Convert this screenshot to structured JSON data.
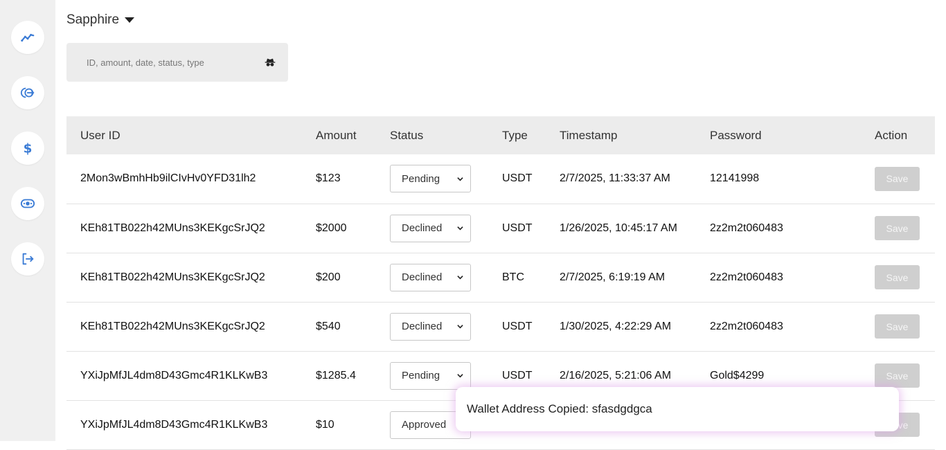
{
  "sidebar": {
    "items": [
      {
        "icon": "chart-line-icon",
        "label": "Analytics"
      },
      {
        "icon": "transfer-icon",
        "label": "Transfers"
      },
      {
        "icon": "dollar-icon",
        "label": "Transactions"
      },
      {
        "icon": "money-icon",
        "label": "Payments"
      },
      {
        "icon": "logout-icon",
        "label": "Logout"
      }
    ],
    "accent_color": "#3a7bd5"
  },
  "site": {
    "selected": "Sapphire"
  },
  "search": {
    "placeholder": "ID, amount, date, status, type"
  },
  "table": {
    "headers": [
      "User ID",
      "Amount",
      "Status",
      "Type",
      "Timestamp",
      "Password",
      "Action"
    ],
    "rows": [
      {
        "user_id": "2Mon3wBmhHb9ilCIvHv0YFD31lh2",
        "amount": "$123",
        "status": "Pending",
        "type": "USDT",
        "timestamp": "2/7/2025, 11:33:37 AM",
        "password": "12141998",
        "action": "Save"
      },
      {
        "user_id": "KEh81TB022h42MUns3KEKgcSrJQ2",
        "amount": "$2000",
        "status": "Declined",
        "type": "USDT",
        "timestamp": "1/26/2025, 10:45:17 AM",
        "password": "2z2m2t060483",
        "action": "Save"
      },
      {
        "user_id": "KEh81TB022h42MUns3KEKgcSrJQ2",
        "amount": "$200",
        "status": "Declined",
        "type": "BTC",
        "timestamp": "2/7/2025, 6:19:19 AM",
        "password": "2z2m2t060483",
        "action": "Save"
      },
      {
        "user_id": "KEh81TB022h42MUns3KEKgcSrJQ2",
        "amount": "$540",
        "status": "Declined",
        "type": "USDT",
        "timestamp": "1/30/2025, 4:22:29 AM",
        "password": "2z2m2t060483",
        "action": "Save"
      },
      {
        "user_id": "YXiJpMfJL4dm8D43Gmc4R1KLKwB3",
        "amount": "$1285.4",
        "status": "Pending",
        "type": "USDT",
        "timestamp": "2/16/2025, 5:21:06 AM",
        "password": "Gold$4299",
        "action": "Save"
      },
      {
        "user_id": "YXiJpMfJL4dm8D43Gmc4R1KLKwB3",
        "amount": "$10",
        "status": "Approved",
        "type": "",
        "timestamp": "",
        "password": "",
        "action": "Save"
      }
    ]
  },
  "toast": {
    "message": "Wallet Address Copied: sfasdgdgca"
  }
}
